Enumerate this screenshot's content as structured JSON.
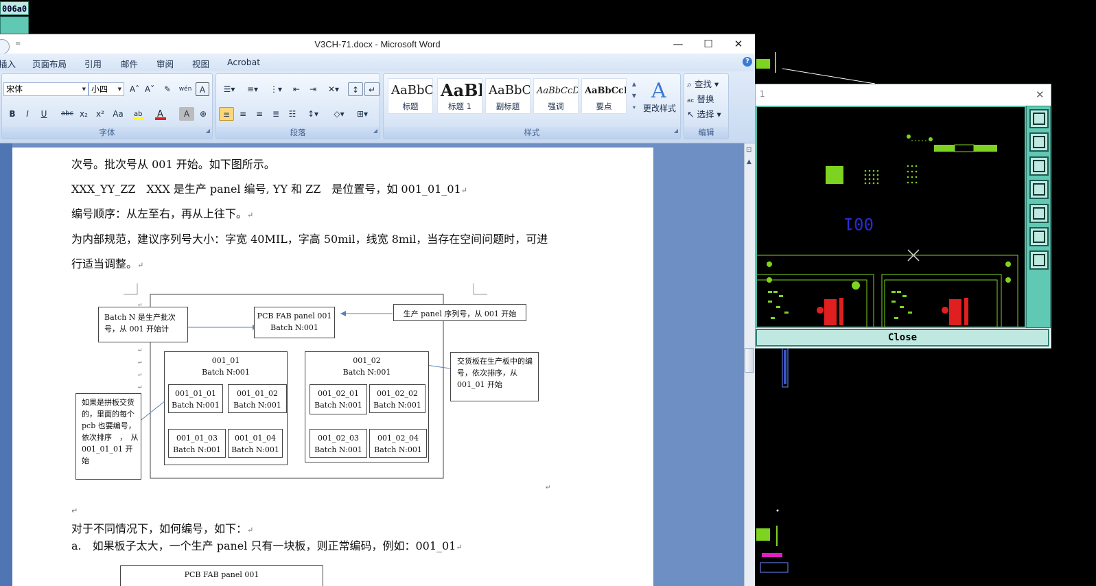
{
  "background_tag": "006a0",
  "word": {
    "quick_access_arrow": "=",
    "title": "V3CH-71.docx - Microsoft Word",
    "window_buttons": {
      "minimize": "—",
      "maximize": "☐",
      "close": "✕"
    },
    "menu": [
      "插入",
      "页面布局",
      "引用",
      "邮件",
      "审阅",
      "视图",
      "Acrobat"
    ],
    "font_group": {
      "label": "字体",
      "font_name": "宋体",
      "font_size": "小四",
      "grow": "A˄",
      "shrink": "A˅",
      "buttons": [
        "B",
        "I",
        "U",
        "abc",
        "x₂",
        "x²",
        "Aa"
      ],
      "highlight_color": "#ffff00",
      "font_color": "#e02020"
    },
    "paragraph_group": {
      "label": "段落"
    },
    "styles_group": {
      "label": "样式",
      "styles": [
        {
          "preview": "AaBbC",
          "name": "标题"
        },
        {
          "preview": "AaBl",
          "name": "标题 1"
        },
        {
          "preview": "AaBbC",
          "name": "副标题"
        },
        {
          "preview": "AaBbCcD",
          "name": "强调"
        },
        {
          "preview": "AaBbCcD",
          "name": "要点"
        }
      ],
      "change_styles": "更改样式"
    },
    "editing_group": {
      "label": "编辑",
      "find": "查找",
      "replace": "替换",
      "select": "选择"
    },
    "doc": {
      "lines": [
        "次号。批次号从 001 开始。如下图所示。",
        "XXX_YY_ZZ　XXX  是生产 panel 编号, YY  和  ZZ　是位置号，如 001_01_01",
        "编号顺序：从左至右，再从上往下。",
        "为内部规范，建议序列号大小：字宽 40MIL，字高 50mil，线宽 8mil，当存在空间问题时，可进",
        "行适当调整。",
        "对于不同情况下，如何编号，如下：",
        "a.　如果板子太大，一个生产 panel 只有一块板，则正常编码，例如：001_01"
      ],
      "diagram": {
        "batch_note": "Batch  N  是生产批次号，从 001 开始计",
        "panel_title": "PCB FAB panel 001",
        "panel_batch": "Batch N:001",
        "serial_note": "生产 panel  序列号，从 001 开始",
        "swap_note": "交货板在生产板中的编号，依次排序，从 001_01 开始",
        "pcb_note": "如果是拼板交货的，里面的每个 pcb  也要编号，依次排序　，　从 001_01_01  开始",
        "boards": [
          {
            "name": "001_01",
            "batch": "Batch N:001"
          },
          {
            "name": "001_02",
            "batch": "Batch N:001"
          }
        ],
        "pcbs": [
          {
            "name": "001_01_01",
            "batch": "Batch N:001"
          },
          {
            "name": "001_01_02",
            "batch": "Batch N:001"
          },
          {
            "name": "001_01_03",
            "batch": "Batch N:001"
          },
          {
            "name": "001_01_04",
            "batch": "Batch N:001"
          },
          {
            "name": "001_02_01",
            "batch": "Batch N:001"
          },
          {
            "name": "001_02_02",
            "batch": "Batch N:001"
          },
          {
            "name": "001_02_03",
            "batch": "Batch N:001"
          },
          {
            "name": "001_02_04",
            "batch": "Batch N:001"
          }
        ]
      },
      "bottom_box_title": "PCB FAB panel 001"
    }
  },
  "cad": {
    "title": "1",
    "close_x": "✕",
    "silkscreen_text": "001",
    "close_button": "Close",
    "colors": {
      "board": "#7ed321",
      "text": "#2a2ad8",
      "parts": "#e02020",
      "frame": "#4fbda8"
    }
  }
}
